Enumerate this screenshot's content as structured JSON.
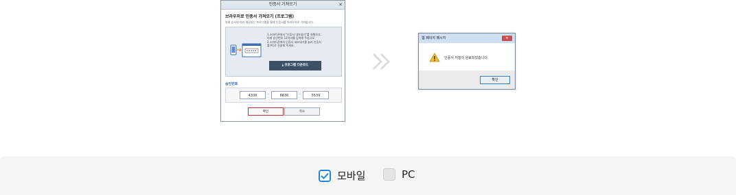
{
  "dialog": {
    "title": "인증서 가져오기",
    "close": "✕",
    "heading": "브라우저로 인증서 가져오기 (프로그램)",
    "description": "아래 순서에 따라 제공되는 프로그램을 통해 인증서를 브라우저로 가져옵니다.",
    "steps": [
      "1.스마트폰에서 \"인증서 내보내기\"를 실행하고,",
      "  아래 승인번호 12자리를 입력해 주십시오.",
      "2.스마트폰에서 인증서 내보내기를 눌러 인증서",
      "  를 PC로 전송해 주세요."
    ],
    "download_label": "프로그램 다운로드",
    "auth_label": "승인번호",
    "codes": [
      "4308",
      "6836",
      "5539"
    ],
    "dash": "-",
    "ok_label": "확인",
    "cancel_label": "취소"
  },
  "message_box": {
    "title": "웹 페이지 메시지",
    "close": "✕",
    "message": "인증서 저장이 완료되었습니다.",
    "ok_label": "확인"
  },
  "options": {
    "mobile": {
      "label": "모바일",
      "checked": true
    },
    "pc": {
      "label": "PC",
      "checked": false
    }
  },
  "colors": {
    "accent": "#1f86e0",
    "download_button": "#3d5166",
    "auth_label": "#3366aa"
  }
}
